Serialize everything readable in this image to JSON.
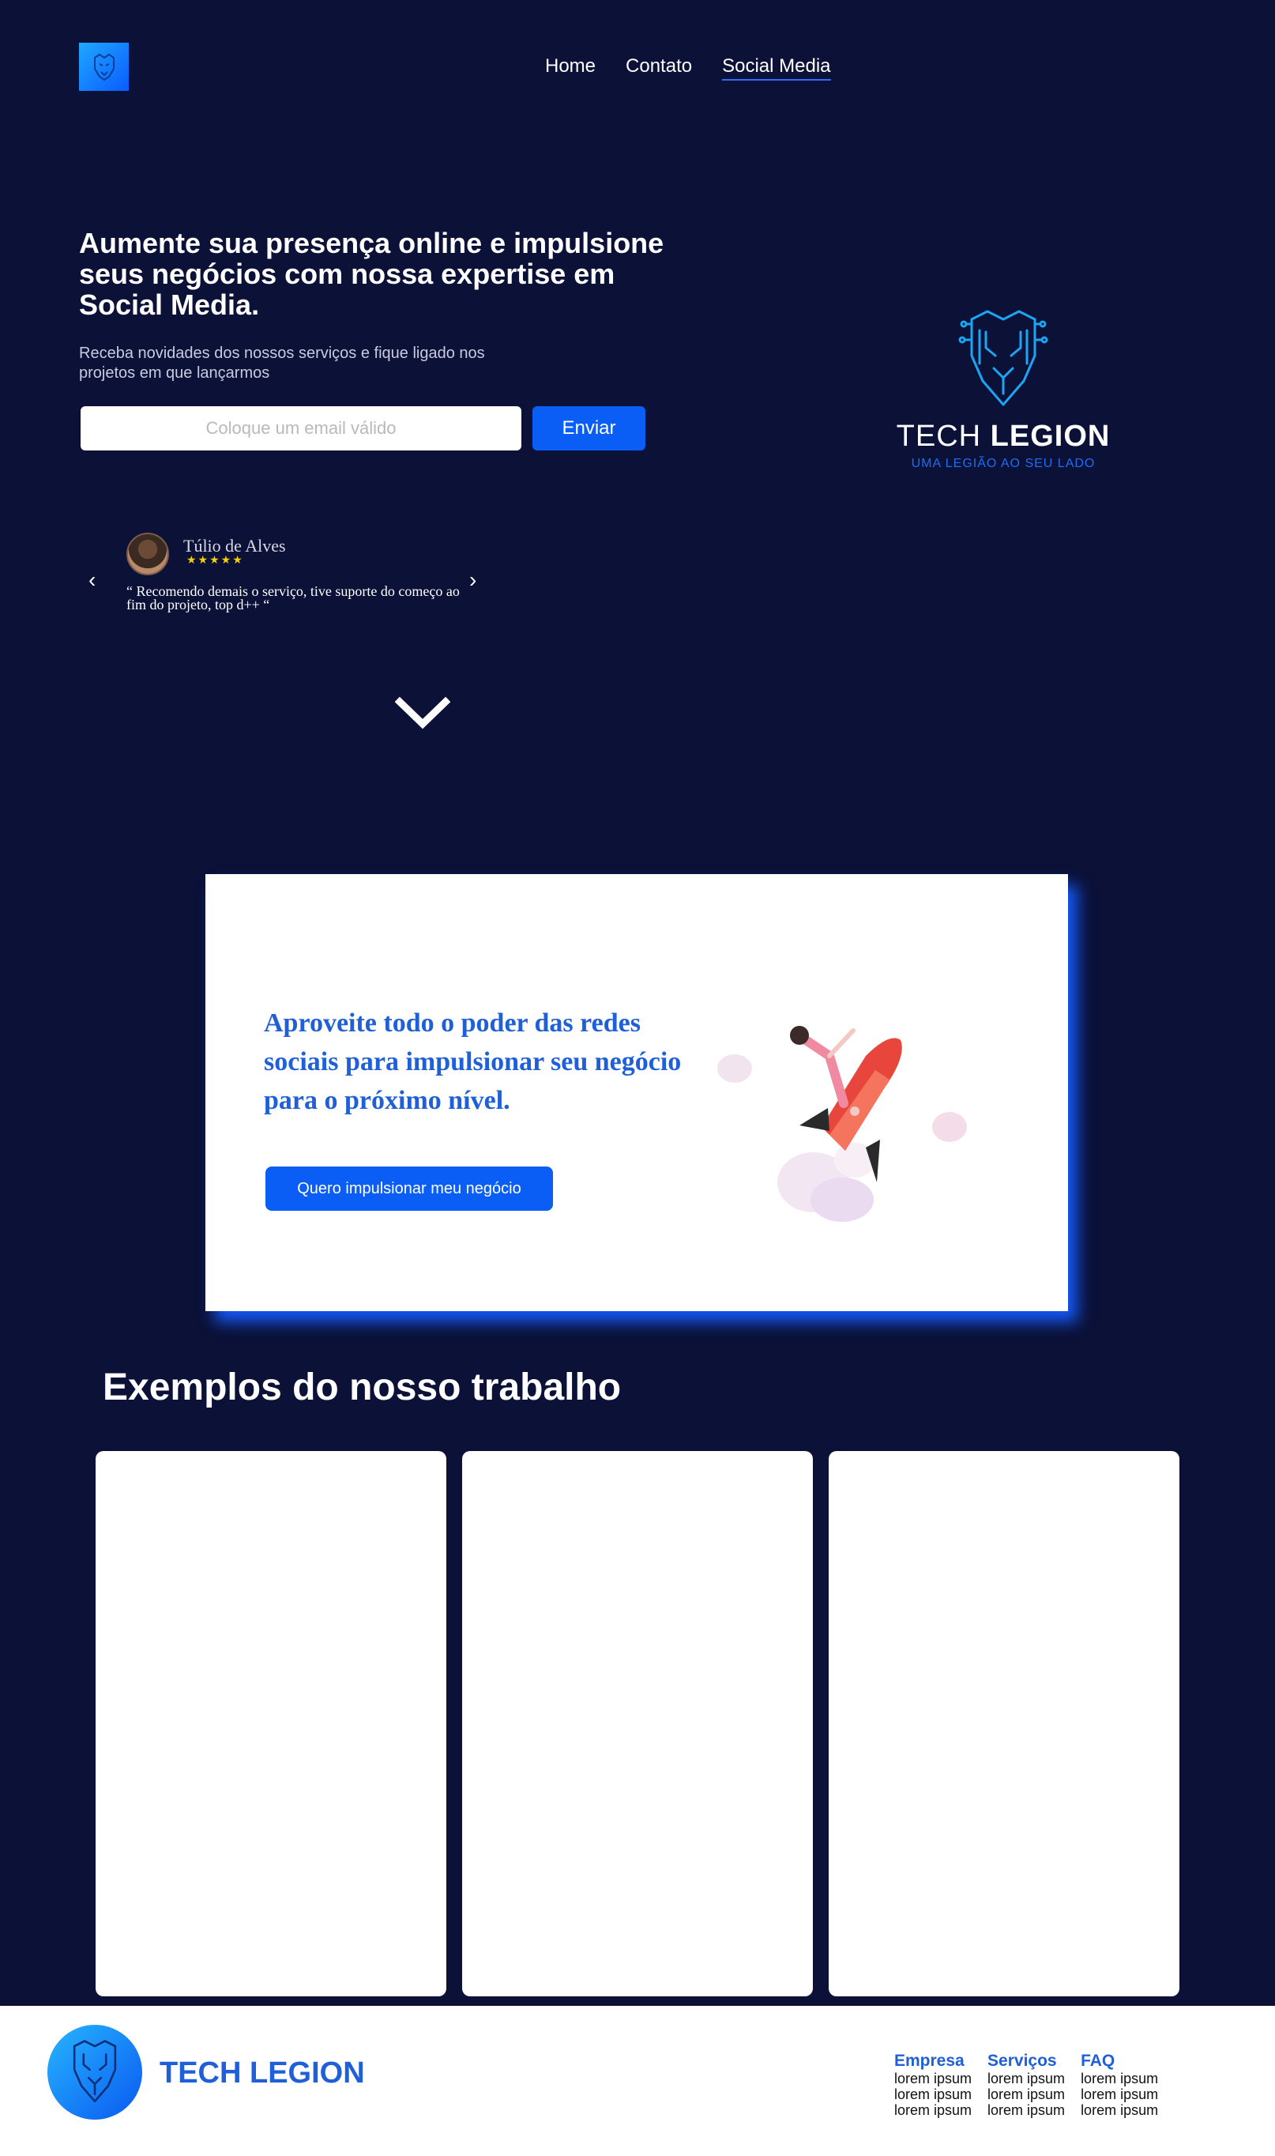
{
  "colors": {
    "background": "#0b1137",
    "accent": "#0a5ef5",
    "brand_blue": "#1f5fd8",
    "card": "#ffffff",
    "star": "#f5d000"
  },
  "header": {
    "logo_icon": "lion-circuit-icon",
    "nav": [
      {
        "label": "Home"
      },
      {
        "label": "Contato"
      },
      {
        "label": "Social Media",
        "active": true
      }
    ]
  },
  "hero": {
    "title": "Aumente sua presença online e impulsione seus negócios com nossa expertise em Social Media.",
    "subtitle": "Receba novidades dos nossos serviços e fique ligado nos projetos em que lançarmos",
    "email_placeholder": "Coloque um email válido",
    "email_value": "",
    "send_label": "Enviar"
  },
  "brand": {
    "icon": "lion-circuit-icon",
    "name_light": "TECH",
    "name_bold": "LEGION",
    "tagline": "UMA LEGIÃO AO SEU LADO"
  },
  "testimonial": {
    "name": "Túlio de Alves",
    "stars": "★★★★★",
    "rating": 5,
    "text": "“ Recomendo demais o serviço, tive suporte do começo ao fim do projeto, top d++ “",
    "prev_icon": "chevron-left-icon",
    "next_icon": "chevron-right-icon"
  },
  "scroll_icon": "chevron-down-icon",
  "cta": {
    "title": "Aproveite todo o poder das redes sociais para impulsionar seu negócio para o próximo nível.",
    "button_label": "Quero impulsionar meu negócio",
    "illustration": "rocket-illustration"
  },
  "examples": {
    "title": "Exemplos do nosso trabalho",
    "cards": [
      {},
      {},
      {}
    ]
  },
  "footer": {
    "logo_icon": "lion-circuit-icon",
    "brand": "TECH LEGION",
    "columns": [
      {
        "title": "Empresa",
        "items": [
          "lorem ipsum",
          "lorem ipsum",
          "lorem ipsum"
        ]
      },
      {
        "title": "Serviços",
        "items": [
          "lorem ipsum",
          "lorem ipsum",
          "lorem ipsum"
        ]
      },
      {
        "title": "FAQ",
        "items": [
          "lorem ipsum",
          "lorem ipsum",
          "lorem ipsum"
        ]
      }
    ]
  }
}
